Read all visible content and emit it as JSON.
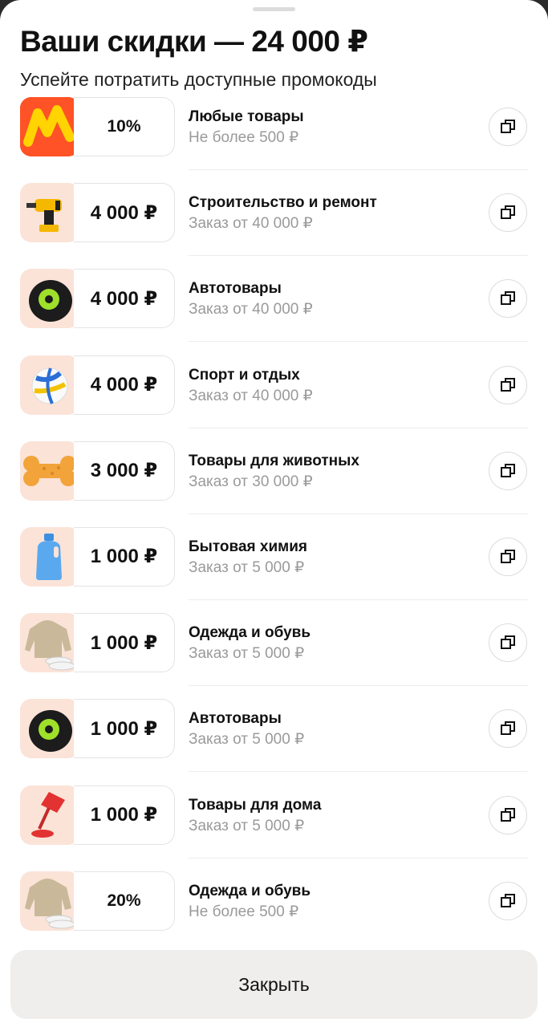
{
  "header": {
    "title": "Ваши скидки — 24 000 ₽",
    "subtitle": "Успейте потратить доступные промокоды"
  },
  "promos": [
    {
      "amount": "10%",
      "name": "Любые товары",
      "condition": "Не более 500 ₽",
      "icon": "brand-logo-icon"
    },
    {
      "amount": "4 000 ₽",
      "name": "Строительство и ремонт",
      "condition": "Заказ от 40 000 ₽",
      "icon": "drill-icon"
    },
    {
      "amount": "4 000 ₽",
      "name": "Автотовары",
      "condition": "Заказ от 40 000 ₽",
      "icon": "tire-icon"
    },
    {
      "amount": "4 000 ₽",
      "name": "Спорт и отдых",
      "condition": "Заказ от 40 000 ₽",
      "icon": "volleyball-icon"
    },
    {
      "amount": "3 000 ₽",
      "name": "Товары для животных",
      "condition": "Заказ от 30 000 ₽",
      "icon": "dog-bone-toy-icon"
    },
    {
      "amount": "1 000 ₽",
      "name": "Бытовая химия",
      "condition": "Заказ от 5 000 ₽",
      "icon": "detergent-bottle-icon"
    },
    {
      "amount": "1 000 ₽",
      "name": "Одежда и обувь",
      "condition": "Заказ от 5 000 ₽",
      "icon": "hoodie-sneakers-icon"
    },
    {
      "amount": "1 000 ₽",
      "name": "Автотовары",
      "condition": "Заказ от 5 000 ₽",
      "icon": "tire-icon"
    },
    {
      "amount": "1 000 ₽",
      "name": "Товары для дома",
      "condition": "Заказ от 5 000 ₽",
      "icon": "desk-lamp-icon"
    },
    {
      "amount": "20%",
      "name": "Одежда и обувь",
      "condition": "Не более 500 ₽",
      "icon": "hoodie-sneakers-icon"
    }
  ],
  "footer": {
    "close_label": "Закрыть"
  },
  "colors": {
    "brand": "#ff5226",
    "thumb_bg": "#fbe3d8",
    "muted_text": "#9a9a9a",
    "button_bg": "#efeeec"
  }
}
